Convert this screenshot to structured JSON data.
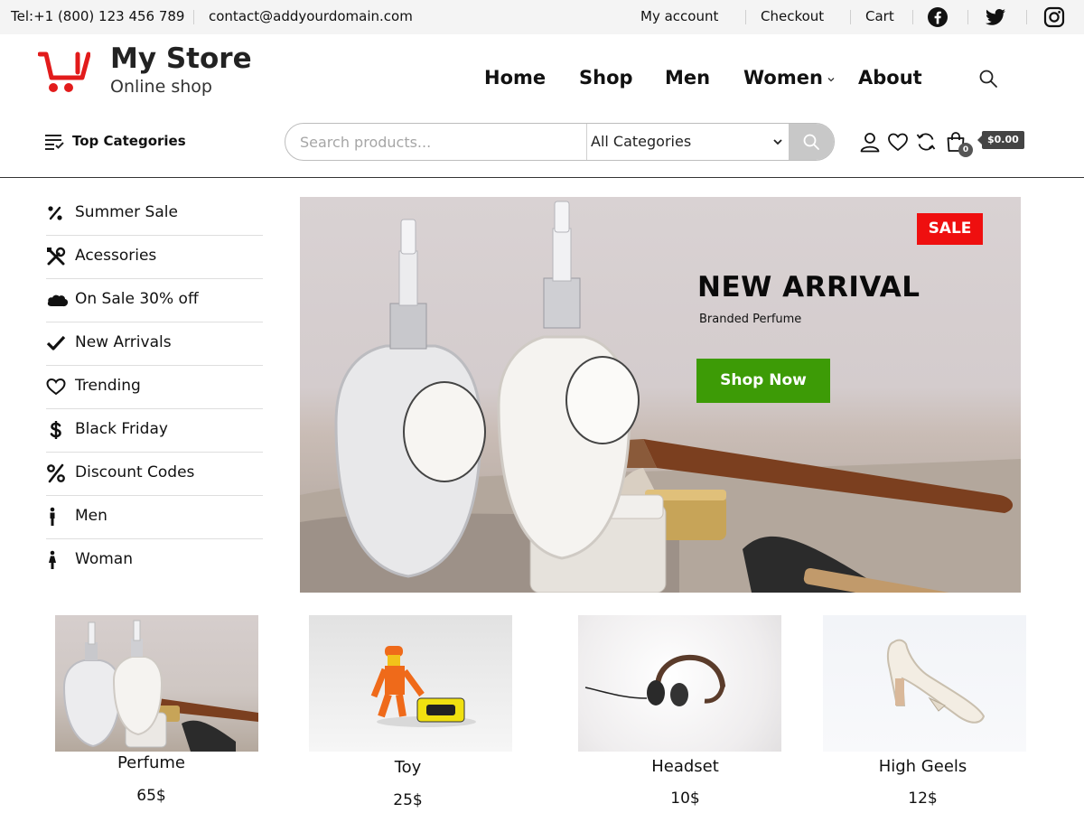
{
  "topbar": {
    "phone": "Tel:+1 (800) 123 456 789",
    "email": "contact@addyourdomain.com",
    "links": [
      "My account",
      "Checkout",
      "Cart"
    ],
    "social": [
      "facebook-icon",
      "twitter-icon",
      "instagram-icon"
    ]
  },
  "brand": {
    "name": "My Store",
    "tagline": "Online shop",
    "accent": "#e21b1b"
  },
  "nav": {
    "items": [
      "Home",
      "Shop",
      "Men",
      "Women",
      "About"
    ]
  },
  "categories_bar": {
    "label": "Top Categories",
    "search_placeholder": "Search products...",
    "category_select": "All Categories",
    "cart_count": "0",
    "cart_total": "$0.00"
  },
  "sidebar": {
    "items": [
      {
        "label": "Summer Sale",
        "icon": "percent-small-icon"
      },
      {
        "label": "Acessories",
        "icon": "tools-icon"
      },
      {
        "label": "On Sale 30% off",
        "icon": "cloud-icon"
      },
      {
        "label": "New Arrivals",
        "icon": "check-icon"
      },
      {
        "label": "Trending",
        "icon": "heart-icon"
      },
      {
        "label": "Black Friday",
        "icon": "dollar-icon"
      },
      {
        "label": "Discount Codes",
        "icon": "percent-icon"
      },
      {
        "label": "Men",
        "icon": "man-icon"
      },
      {
        "label": "Woman",
        "icon": "woman-icon"
      }
    ]
  },
  "banner": {
    "badge": "SALE",
    "title": "NEW ARRIVAL",
    "subtitle": "Branded Perfume",
    "button": "Shop Now",
    "badge_color": "#ef0f0f",
    "button_color": "#3d9b06"
  },
  "products": [
    {
      "name": "Perfume",
      "price": "65$"
    },
    {
      "name": "Toy",
      "price": "25$"
    },
    {
      "name": "Headset",
      "price": "10$"
    },
    {
      "name": "High Geels",
      "price": "12$"
    }
  ]
}
